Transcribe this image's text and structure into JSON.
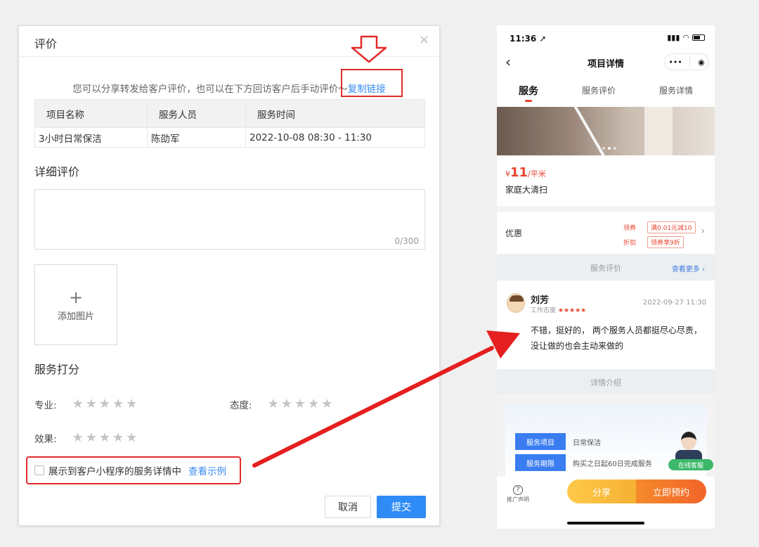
{
  "dialog": {
    "title": "评价",
    "close_icon": "×",
    "share_text": "您可以分享转发给客户评价，也可以在下方回访客户后手动评价～",
    "copy_link": "复制链接",
    "table": {
      "headers": [
        "项目名称",
        "服务人员",
        "服务时间"
      ],
      "row": [
        "3小时日常保洁",
        "陈劭军",
        "2022-10-08 08:30 - 11:30"
      ]
    },
    "detail_title": "详细评价",
    "char_count": "0/300",
    "upload_plus": "+",
    "upload_label": "添加图片",
    "score_title": "服务打分",
    "ratings": {
      "professional": "专业:",
      "attitude": "态度:",
      "effect": "效果:"
    },
    "stars": "★★★★★",
    "checkbox_label": "展示到客户小程序的服务详情中",
    "view_example": "查看示例",
    "cancel": "取消",
    "submit": "提交"
  },
  "phone": {
    "status_time": "11:36 ➚",
    "status_signal": "▮▮▮",
    "status_wifi": "◠",
    "nav_back": "‹",
    "nav_title": "项目详情",
    "capsule_more": "•••",
    "capsule_close": "◉",
    "tabs": [
      "服务",
      "服务评价",
      "服务详情"
    ],
    "price_symbol": "¥",
    "price_value": "11",
    "price_unit": "/平米",
    "service_name": "家庭大清扫",
    "promo_label": "优惠",
    "promo_tag1": "领券",
    "promo_coupon1": "满0.01元减10",
    "promo_tag2": "折扣",
    "promo_coupon2": "领券享9折",
    "promo_chevron": "›",
    "review_section": "服务评价",
    "view_more": "查看更多 ›",
    "reviewer": "刘芳",
    "attitude_label": "工作态度",
    "attitude_stars": "★★★★★",
    "review_time": "2022-09-27 11:30",
    "review_text": "不错，挺好的， 两个服务人员都挺尽心尽责，没让做的也会主动来做的",
    "detail_section": "详情介绍",
    "detail_rows": [
      {
        "key": "服务项目",
        "value": "日常保洁"
      },
      {
        "key": "服务期限",
        "value": "购买之日起60日完成服务"
      }
    ],
    "online_service": "在线客服",
    "tip_icon": "?",
    "tip_label": "推广声明",
    "share_button": "分享",
    "book_button": "立即预约"
  }
}
